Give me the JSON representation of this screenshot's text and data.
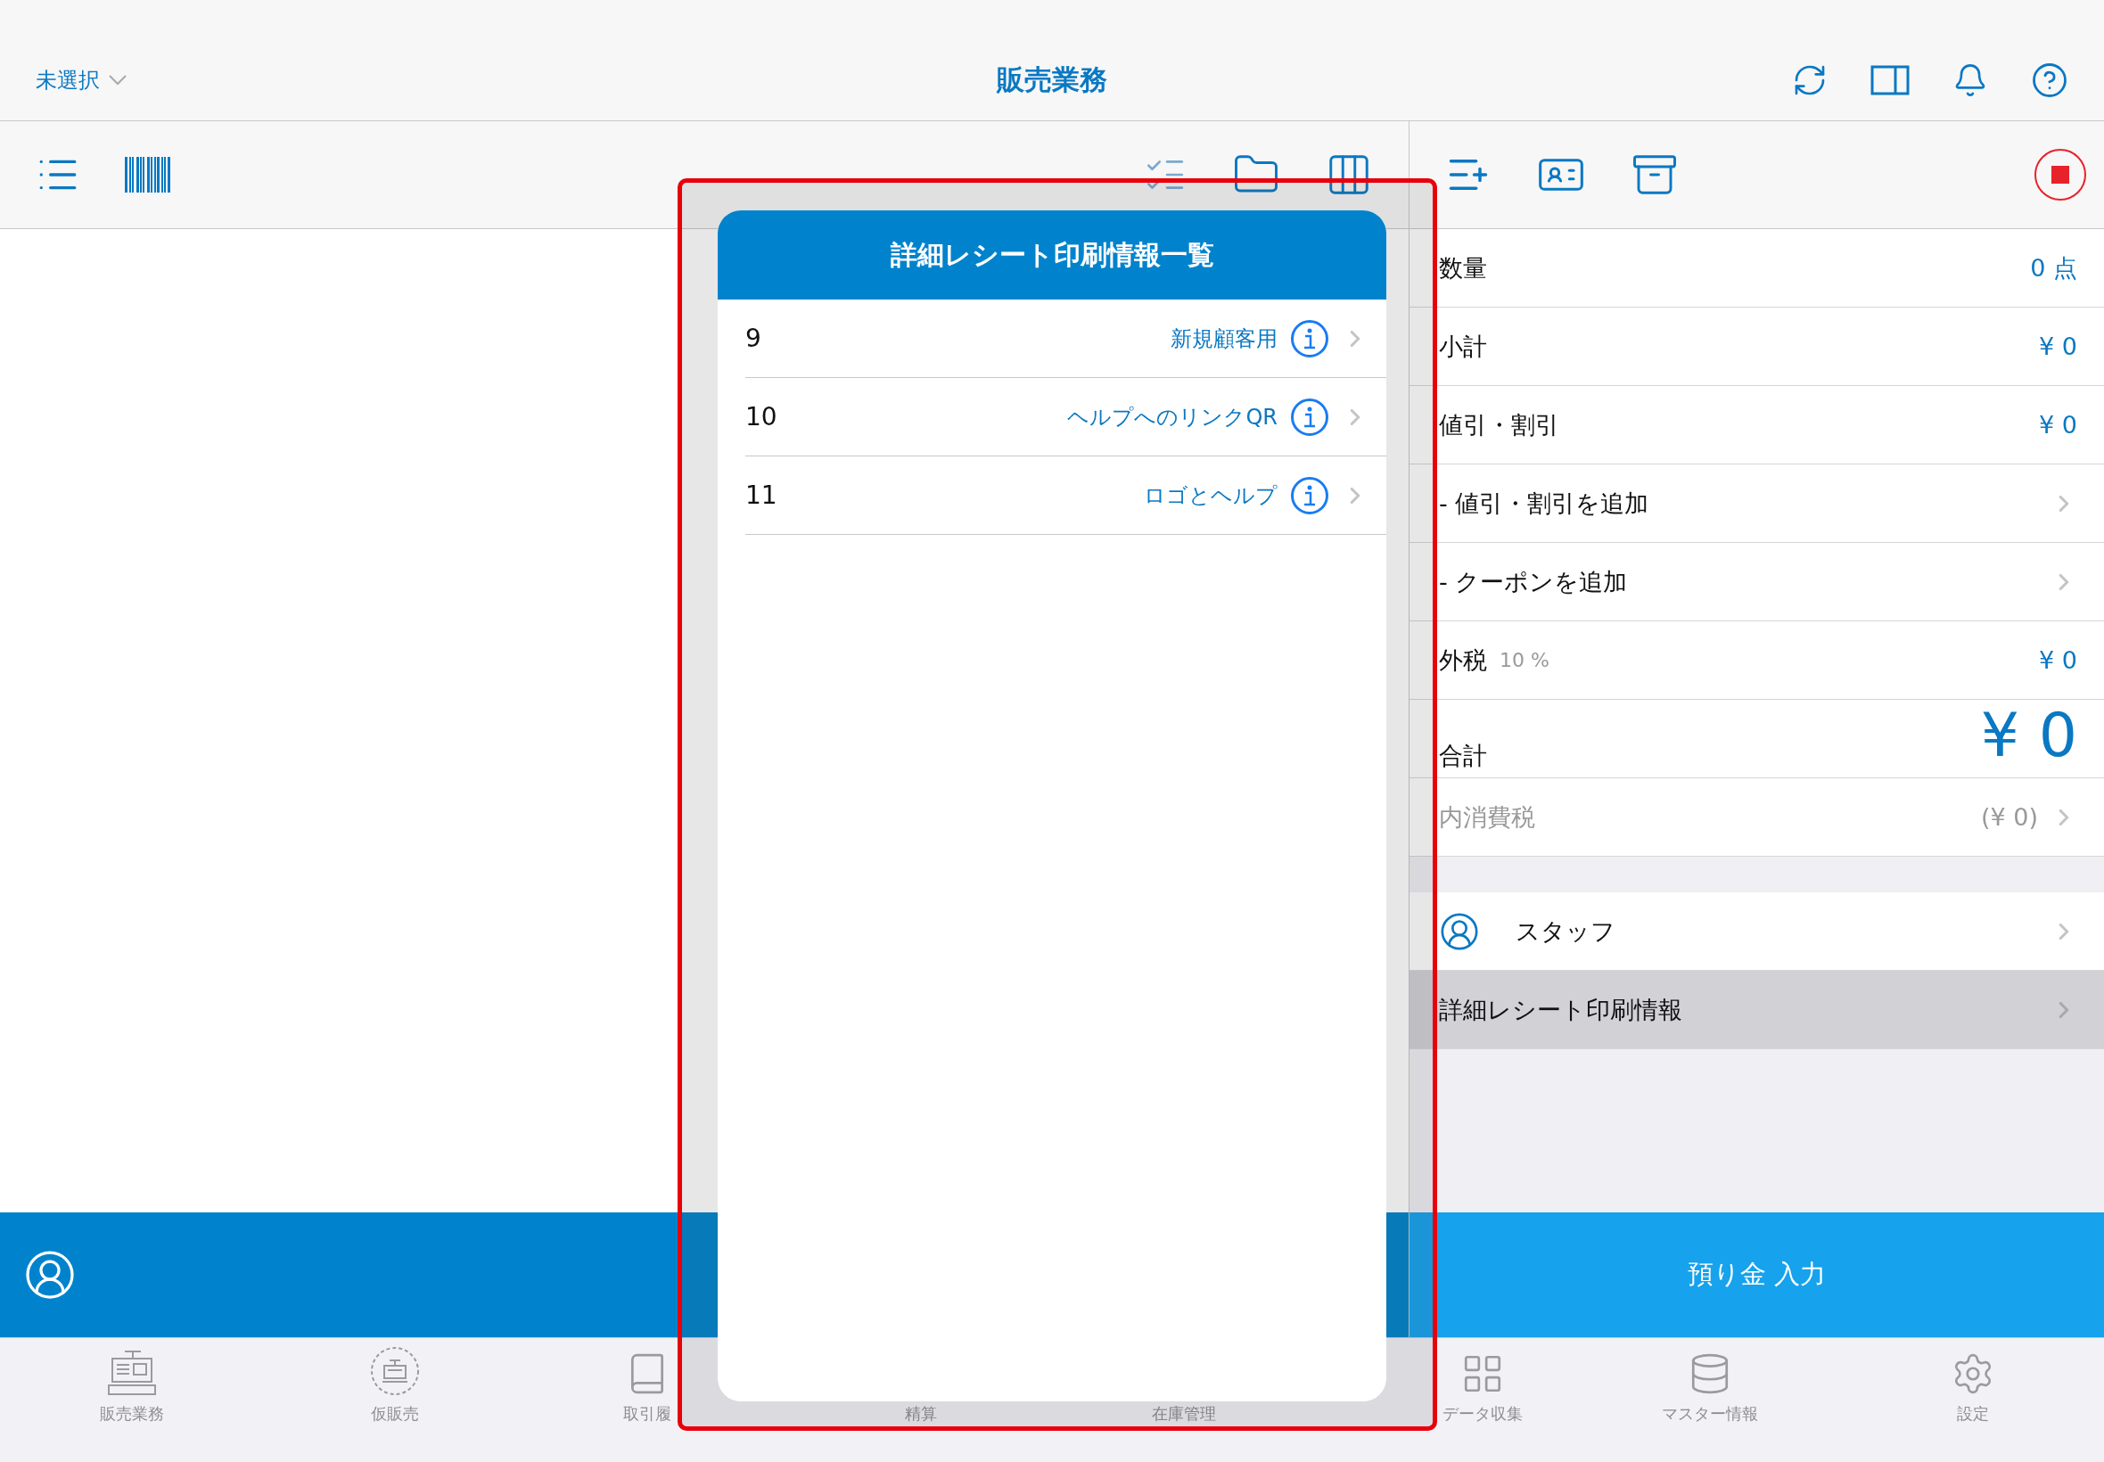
{
  "header": {
    "store": "未選択",
    "title": "販売業務"
  },
  "summary": [
    {
      "kind": "amount",
      "label": "数量",
      "value": "0 点"
    },
    {
      "kind": "amount",
      "label": "小計",
      "value": "¥ 0"
    },
    {
      "kind": "amount",
      "label": "値引・割引",
      "value": "¥ 0"
    },
    {
      "kind": "action",
      "label": "- 値引・割引を追加"
    },
    {
      "kind": "action",
      "label": "- クーポンを追加"
    },
    {
      "kind": "tax",
      "label": "外税",
      "note": "10 %",
      "value": "¥ 0"
    },
    {
      "kind": "total",
      "label": "合計",
      "value": "¥ 0"
    },
    {
      "kind": "included",
      "label": "内消費税",
      "value": "(¥ 0)"
    }
  ],
  "staff": {
    "label": "スタッフ"
  },
  "receipt_info": {
    "label": "詳細レシート印刷情報",
    "selected": true
  },
  "deposit_button": "預り金 入力",
  "tabs": [
    {
      "kind": "register",
      "label": "販売業務"
    },
    {
      "kind": "pending",
      "label": "仮販売"
    },
    {
      "kind": "history",
      "label": "取引履"
    },
    {
      "kind": "hidden",
      "label": "精算"
    },
    {
      "kind": "hidden",
      "label": "在庫管理"
    },
    {
      "kind": "collect",
      "label": "データ収集"
    },
    {
      "kind": "database",
      "label": "マスター情報"
    },
    {
      "kind": "settings",
      "label": "設定"
    }
  ],
  "popover": {
    "title": "詳細レシート印刷情報一覧",
    "items": [
      {
        "number": "9",
        "name": "新規顧客用"
      },
      {
        "number": "10",
        "name": "ヘルプへのリンクQR"
      },
      {
        "number": "11",
        "name": "ロゴとヘルプ"
      }
    ]
  }
}
